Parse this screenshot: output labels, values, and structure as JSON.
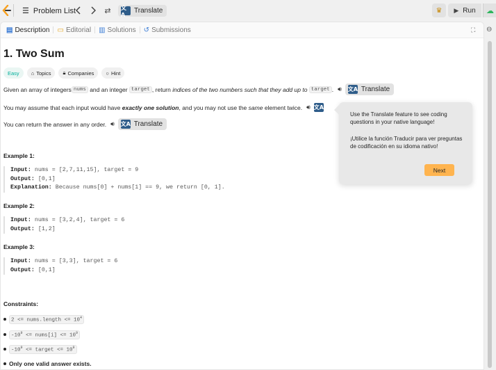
{
  "topbar": {
    "problem_list_label": "Problem List",
    "translate_label": "Translate",
    "run_label": "Run",
    "translate_icon": "文A"
  },
  "tabs": [
    {
      "label": "Description",
      "icon": "description-icon"
    },
    {
      "label": "Editorial",
      "icon": "editorial-icon"
    },
    {
      "label": "Solutions",
      "icon": "solutions-icon"
    },
    {
      "label": "Submissions",
      "icon": "submissions-icon"
    }
  ],
  "problem": {
    "title": "1. Two Sum",
    "badges": {
      "difficulty": "Easy",
      "topics": "Topics",
      "companies": "Companies",
      "hint": "Hint"
    },
    "p1": {
      "a": "Given an array of integers ",
      "b": "nums",
      "c": " and an integer ",
      "d": "target",
      "e": ", return ",
      "f": "indices of the two numbers such that they add up to ",
      "g": "target",
      "h": "."
    },
    "p2": {
      "a": "You may assume that each input would have ",
      "b": "exactly one solution",
      "c": ", and you may not use the ",
      "d": "same",
      "e": " element twice."
    },
    "p3": "You can return the answer in any order.",
    "translate_label": "Translate",
    "examples": [
      {
        "heading": "Example 1:",
        "input_label": "Input:",
        "input": "nums = [2,7,11,15], target = 9",
        "output_label": "Output:",
        "output": "[0,1]",
        "explanation_label": "Explanation:",
        "explanation": "Because nums[0] + nums[1] == 9, we return [0, 1]."
      },
      {
        "heading": "Example 2:",
        "input_label": "Input:",
        "input": "nums = [3,2,4], target = 6",
        "output_label": "Output:",
        "output": "[1,2]"
      },
      {
        "heading": "Example 3:",
        "input_label": "Input:",
        "input": "nums = [3,3], target = 6",
        "output_label": "Output:",
        "output": "[0,1]"
      }
    ],
    "constraints_heading": "Constraints:",
    "constraints": [
      {
        "a": "2 <= nums.length <= 10",
        "sup": "4"
      },
      {
        "a": "-10",
        "sup": "9",
        "b": " <= nums[i] <= 10",
        "sup2": "9"
      },
      {
        "a": "-10",
        "sup": "9",
        "b": " <= target <= 10",
        "sup2": "9"
      }
    ],
    "final_note": "Only one valid answer exists."
  },
  "tooltip": {
    "text_en": "Use the Translate feature to see coding questions in your native language!",
    "text_es": "¡Utilice la función Traducir para ver preguntas de codificación en su idioma nativo!",
    "next_label": "Next"
  },
  "colors": {
    "easy": "#00af9b",
    "accent": "#ffb44f"
  }
}
